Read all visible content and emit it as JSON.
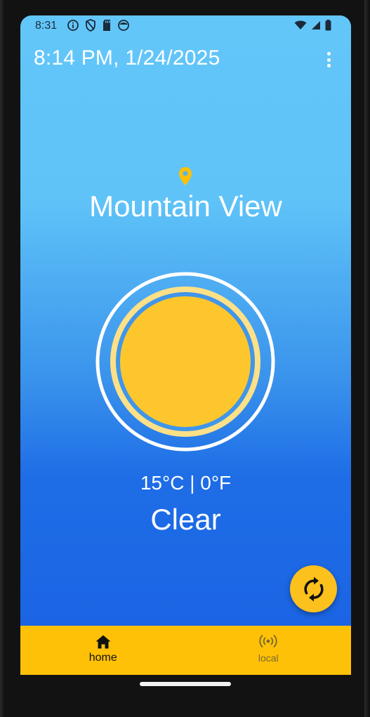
{
  "status_bar": {
    "time": "8:31",
    "left_icons": [
      "info-icon",
      "shield-icon",
      "sd-card-icon",
      "face-icon"
    ],
    "right_icons": [
      "wifi-icon",
      "signal-icon",
      "battery-icon"
    ]
  },
  "app_bar": {
    "title": "8:14 PM, 1/24/2025",
    "menu_icon": "more-vert-icon"
  },
  "weather": {
    "location_icon": "location-pin-icon",
    "city": "Mountain View",
    "condition_icon": "sun-icon",
    "temperature": "15°C | 0°F",
    "condition": "Clear"
  },
  "fab": {
    "icon": "refresh-icon"
  },
  "bottom_nav": {
    "items": [
      {
        "label": "home",
        "icon": "home-icon",
        "active": true
      },
      {
        "label": "local",
        "icon": "broadcast-icon",
        "active": false
      }
    ]
  },
  "colors": {
    "sky_top": "#63c6f9",
    "sky_bottom": "#1a62e4",
    "accent": "#ffc107",
    "sun": "#fdc62c",
    "sun_ring": "#fee087"
  }
}
